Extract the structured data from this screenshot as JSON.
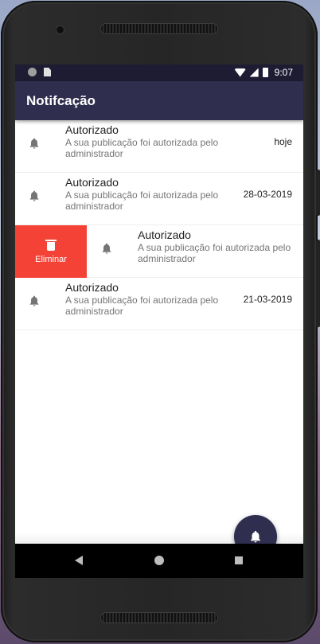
{
  "statusbar": {
    "time": "9:07"
  },
  "appbar": {
    "title": "Notifcação"
  },
  "notifications": [
    {
      "title": "Autorizado",
      "message": "A sua publicação foi autorizada pelo administrador",
      "date": "hoje",
      "icon": "bell-icon"
    },
    {
      "title": "Autorizado",
      "message": "A sua publicação foi autorizada pelo administrador",
      "date": "28-03-2019",
      "icon": "bell-icon"
    },
    {
      "title": "Autorizado",
      "message": "A sua publicação foi autorizada pelo administrador",
      "date": "",
      "icon": "bell-icon",
      "swipe_action": {
        "label": "Eliminar",
        "icon": "trash-icon",
        "color": "#f44336"
      }
    },
    {
      "title": "Autorizado",
      "message": "A sua publicação foi autorizada pelo administrador",
      "date": "21-03-2019",
      "icon": "bell-icon"
    }
  ],
  "fab": {
    "icon": "bell-icon"
  },
  "colors": {
    "appbar": "#2f2e4e",
    "statusbar": "#1d1c33",
    "delete": "#f44336"
  }
}
